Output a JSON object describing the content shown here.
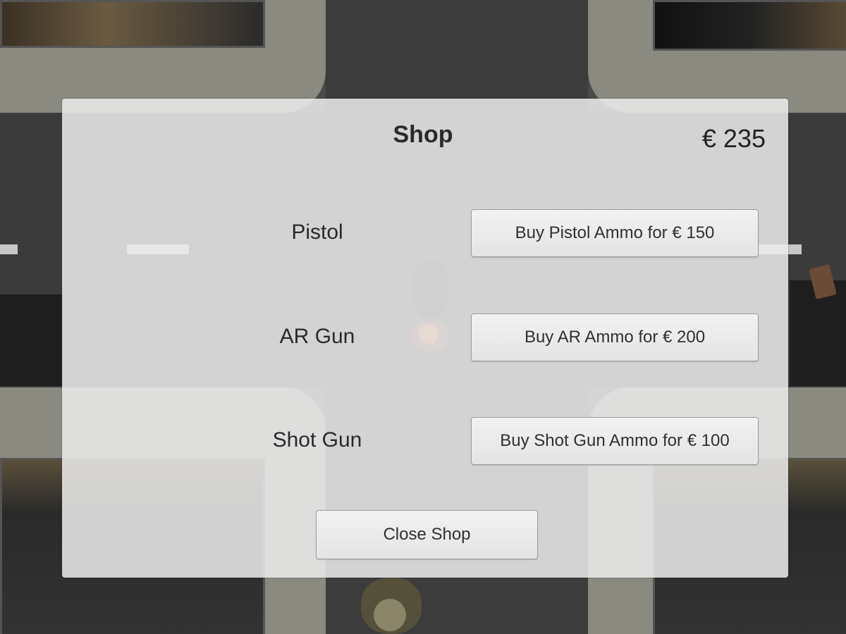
{
  "shop": {
    "title": "Shop",
    "money": "€ 235"
  },
  "weapons": [
    {
      "name": "Pistol",
      "buy_label": "Buy Pistol Ammo for € 150"
    },
    {
      "name": "AR Gun",
      "buy_label": "Buy AR Ammo for € 200"
    },
    {
      "name": "Shot Gun",
      "buy_label": "Buy Shot Gun Ammo for € 100"
    }
  ],
  "close_label": "Close Shop",
  "colors": {
    "panel_bg": "#ececec",
    "button_border": "#9c9c9c",
    "text": "#2a2a2a"
  }
}
